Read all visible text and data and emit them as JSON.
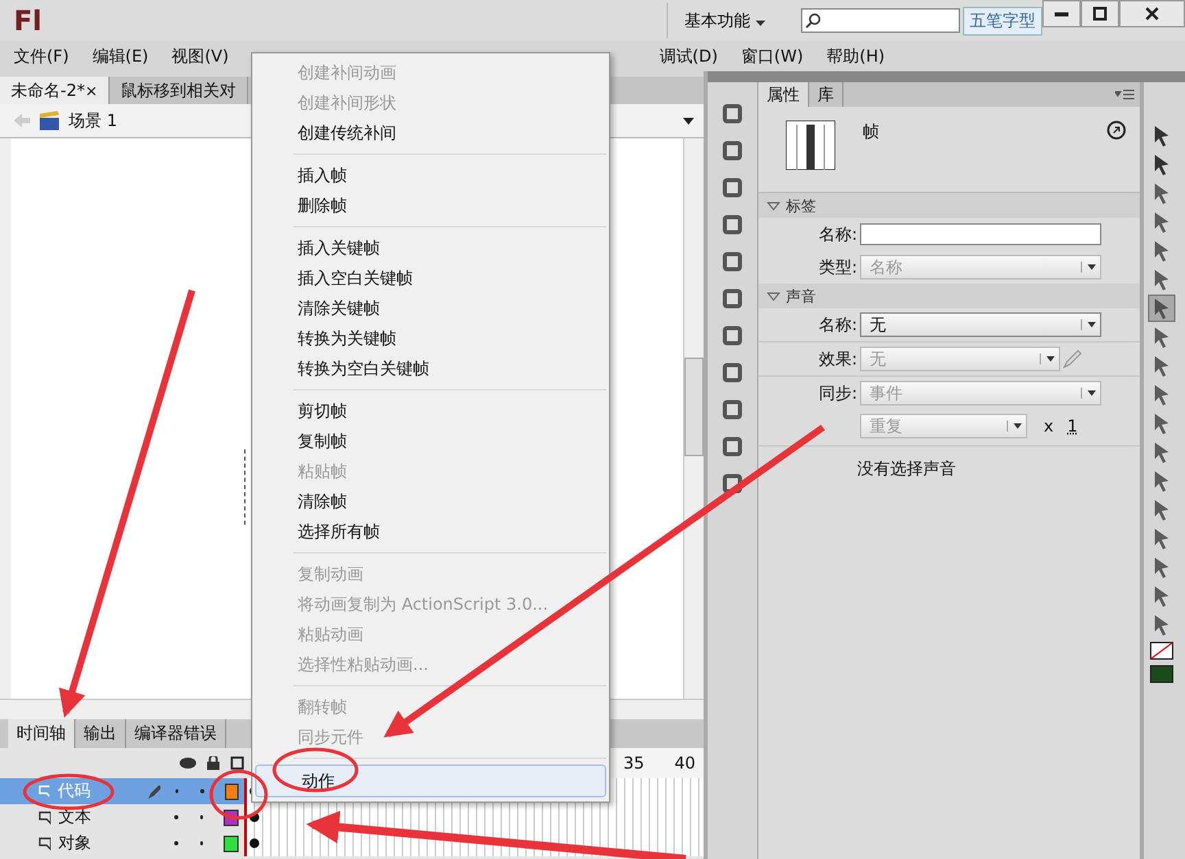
{
  "app": {
    "logo": "Fl",
    "workspace": "基本功能",
    "ime_indicator": "五笔字型"
  },
  "menu_bar": {
    "items_left": [
      "文件(F)",
      "编辑(E)",
      "视图(V)"
    ],
    "items_right": [
      "调试(D)",
      "窗口(W)",
      "帮助(H)"
    ]
  },
  "document_tabs": [
    {
      "label": "未命名-2*",
      "close": "×",
      "selected": true
    },
    {
      "label": "鼠标移到相关对",
      "selected": false
    }
  ],
  "scene": {
    "label": "场景 1"
  },
  "timeline": {
    "tabs": [
      {
        "label": "时间轴",
        "selected": true
      },
      {
        "label": "输出",
        "selected": false
      },
      {
        "label": "编译器错误",
        "selected": false
      }
    ],
    "frame_numbers": [
      "35",
      "40"
    ],
    "layers": [
      {
        "name": "代码",
        "selected": true,
        "color": "#f08010"
      },
      {
        "name": "文本",
        "selected": false,
        "color": "#b030c0"
      },
      {
        "name": "对象",
        "selected": false,
        "color": "#30e040"
      }
    ]
  },
  "properties": {
    "tabs": [
      {
        "label": "属性",
        "selected": true
      },
      {
        "label": "库",
        "selected": false
      }
    ],
    "title": "帧",
    "label_section": {
      "heading": "标签",
      "name_label": "名称:",
      "type_label": "类型:",
      "type_value": "名称",
      "type_disabled": true
    },
    "sound_section": {
      "heading": "声音",
      "name_label": "名称:",
      "name_value": "无",
      "effect_label": "效果:",
      "effect_value": "无",
      "effect_disabled": true,
      "sync_label": "同步:",
      "sync_value": "事件",
      "sync_disabled": true,
      "repeat_value": "重复",
      "repeat_disabled": true,
      "repeat_x": "x",
      "repeat_count": "1",
      "status": "没有选择声音"
    }
  },
  "context_menu": [
    [
      {
        "label": "创建补间动画",
        "disabled": true
      },
      {
        "label": "创建补间形状",
        "disabled": true
      },
      {
        "label": "创建传统补间",
        "disabled": false
      }
    ],
    [
      {
        "label": "插入帧",
        "disabled": false
      },
      {
        "label": "删除帧",
        "disabled": false
      }
    ],
    [
      {
        "label": "插入关键帧",
        "disabled": false
      },
      {
        "label": "插入空白关键帧",
        "disabled": false
      },
      {
        "label": "清除关键帧",
        "disabled": false
      },
      {
        "label": "转换为关键帧",
        "disabled": false
      },
      {
        "label": "转换为空白关键帧",
        "disabled": false
      }
    ],
    [
      {
        "label": "剪切帧",
        "disabled": false
      },
      {
        "label": "复制帧",
        "disabled": false
      },
      {
        "label": "粘贴帧",
        "disabled": true
      },
      {
        "label": "清除帧",
        "disabled": false
      },
      {
        "label": "选择所有帧",
        "disabled": false
      }
    ],
    [
      {
        "label": "复制动画",
        "disabled": true
      },
      {
        "label": "将动画复制为 ActionScript 3.0...",
        "disabled": true
      },
      {
        "label": "粘贴动画",
        "disabled": true
      },
      {
        "label": "选择性粘贴动画...",
        "disabled": true
      }
    ],
    [
      {
        "label": "翻转帧",
        "disabled": true
      },
      {
        "label": "同步元件",
        "disabled": true
      }
    ],
    [
      {
        "label": "动作",
        "disabled": false,
        "highlighted": true
      }
    ]
  ]
}
